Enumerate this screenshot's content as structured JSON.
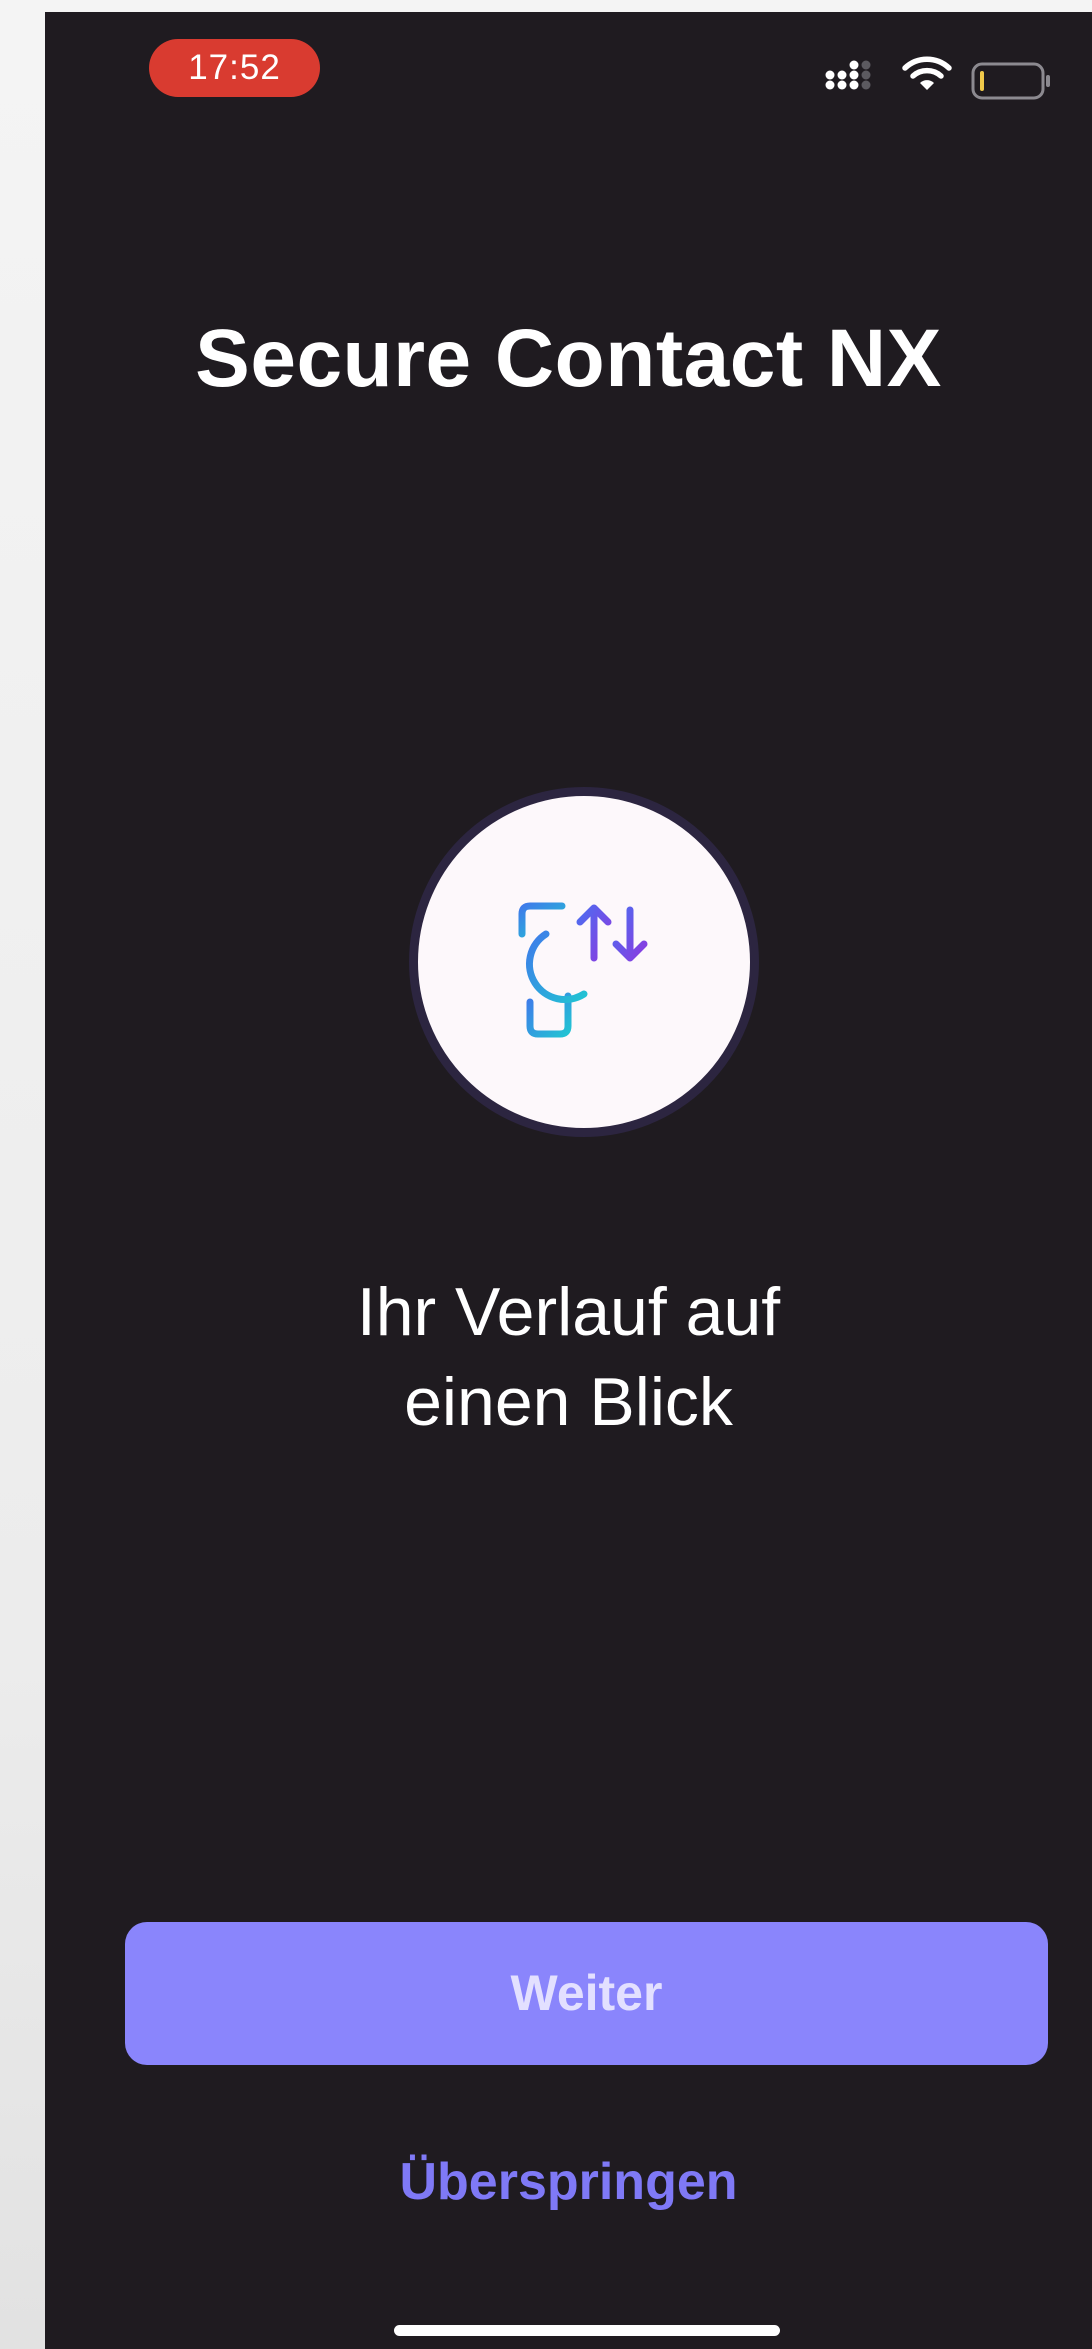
{
  "status_bar": {
    "time": "17:52",
    "time_pill_color": "#d93b30",
    "icons": [
      "signal-icon",
      "wifi-icon",
      "battery-icon"
    ],
    "battery_level": 0.05
  },
  "app": {
    "title": "Secure Contact NX",
    "hero_icon": "history-transfer-icon",
    "subtitle_line1": "Ihr Verlauf auf",
    "subtitle_line2": "einen Blick"
  },
  "actions": {
    "next_label": "Weiter",
    "skip_label": "Überspringen"
  },
  "colors": {
    "background": "#1f1b20",
    "button": "#8a85fc",
    "button_text": "#e3e0ff",
    "link": "#7f79f6"
  }
}
